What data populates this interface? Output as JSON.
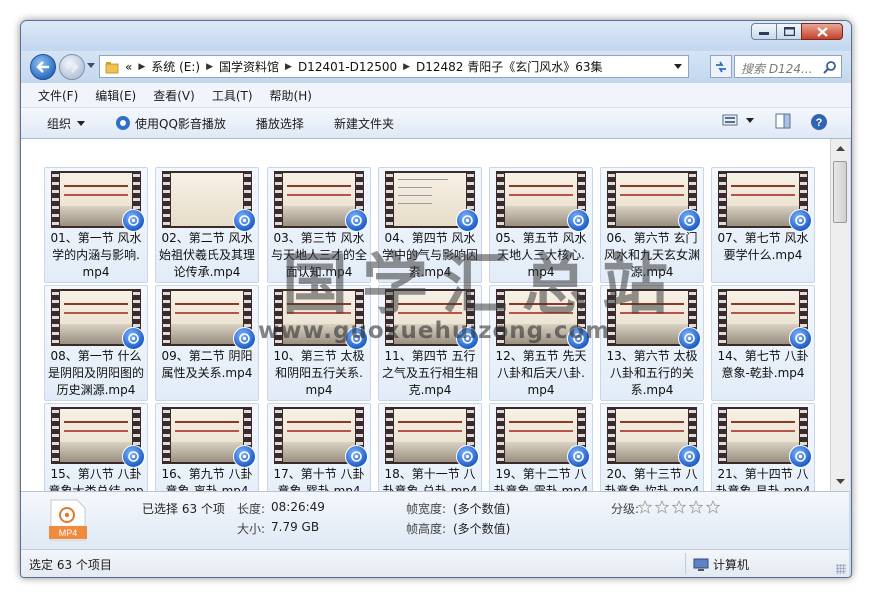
{
  "address": {
    "overflow": "«",
    "crumbs": [
      "系统 (E:)",
      "国学资料馆",
      "D12401-D12500",
      "D12482 青阳子《玄门风水》63集"
    ]
  },
  "search": {
    "placeholder": "搜索 D124..."
  },
  "menu": [
    "文件(F)",
    "编辑(E)",
    "查看(V)",
    "工具(T)",
    "帮助(H)"
  ],
  "toolbar": {
    "organize": "组织",
    "play_qq": "使用QQ影音播放",
    "play_select": "播放选择",
    "new_folder": "新建文件夹"
  },
  "files": [
    {
      "label": "01、第一节 风水学的内涵与影响.mp4",
      "thumb": "course"
    },
    {
      "label": "02、第二节 风水始祖伏羲氏及其理论传承.mp4",
      "thumb": "scene"
    },
    {
      "label": "03、第三节 风水与天地人三才的全面认知.mp4",
      "thumb": "course"
    },
    {
      "label": "04、第四节 风水学中的气与影响因素.mp4",
      "thumb": "doc"
    },
    {
      "label": "05、第五节 风水天地人三大核心.mp4",
      "thumb": "course"
    },
    {
      "label": "06、第六节 玄门风水和九天玄女渊源.mp4",
      "thumb": "course"
    },
    {
      "label": "07、第七节 风水要学什么.mp4",
      "thumb": "course"
    },
    {
      "label": "08、第一节 什么是阴阳及阴阳图的历史渊源.mp4",
      "thumb": "course"
    },
    {
      "label": "09、第二节 阴阳属性及关系.mp4",
      "thumb": "course"
    },
    {
      "label": "10、第三节 太极和阴阳五行关系.mp4",
      "thumb": "course"
    },
    {
      "label": "11、第四节 五行之气及五行相生相克.mp4",
      "thumb": "course"
    },
    {
      "label": "12、第五节 先天八卦和后天八卦.mp4",
      "thumb": "course"
    },
    {
      "label": "13、第六节 太极八卦和五行的关系.mp4",
      "thumb": "course"
    },
    {
      "label": "14、第七节 八卦意象-乾卦.mp4",
      "thumb": "course"
    },
    {
      "label": "15、第八节 八卦意象大类总结.mp4",
      "thumb": "course"
    },
    {
      "label": "16、第九节 八卦意象-离卦.mp4",
      "thumb": "course"
    },
    {
      "label": "17、第十节 八卦意象-巽卦.mp4",
      "thumb": "course"
    },
    {
      "label": "18、第十一节 八卦意象-兑卦.mp4",
      "thumb": "course"
    },
    {
      "label": "19、第十二节 八卦意象-震卦.mp4",
      "thumb": "course"
    },
    {
      "label": "20、第十三节 八卦意象-坎卦.mp4",
      "thumb": "course"
    },
    {
      "label": "21、第十四节 八卦意象-艮卦.mp4",
      "thumb": "course"
    }
  ],
  "details": {
    "file_icon_text": "MP4",
    "selected": "已选择 63 个项",
    "length_label": "长度:",
    "length_value": "08:26:49",
    "size_label": "大小:",
    "size_value": "7.79 GB",
    "width_label": "帧宽度:",
    "width_value": "(多个数值)",
    "height_label": "帧高度:",
    "height_value": "(多个数值)",
    "rating_label": "分级:",
    "rating_stars": 0
  },
  "status": {
    "text": "选定 63 个项目",
    "location": "计算机"
  },
  "watermark": {
    "title": "国学汇总站",
    "url": "www.guoxuehuizong.com"
  }
}
